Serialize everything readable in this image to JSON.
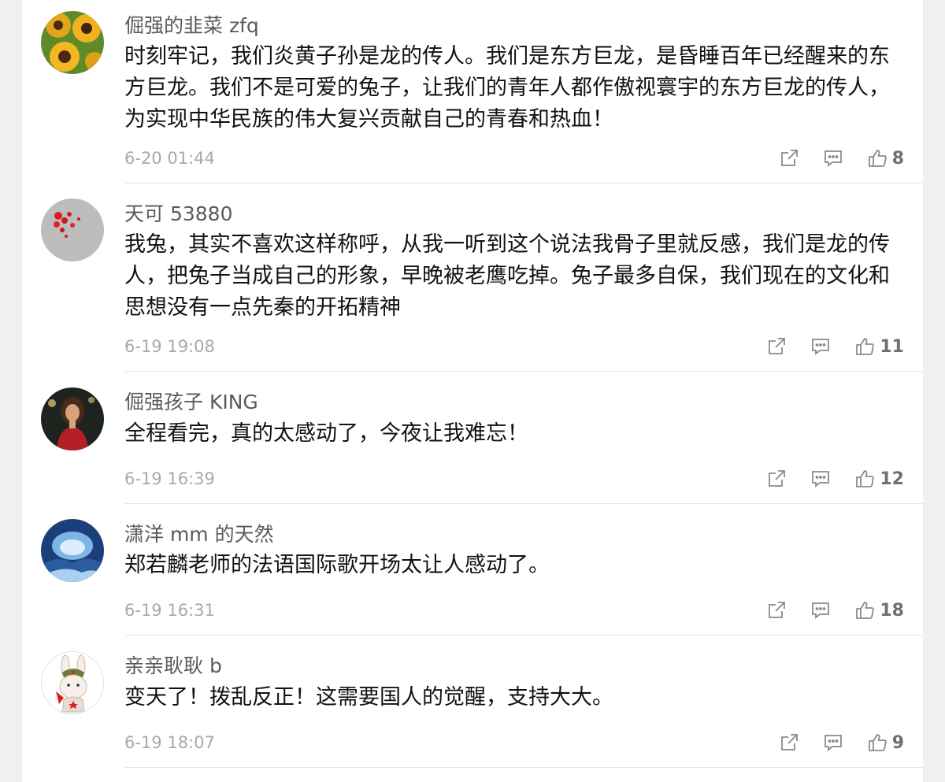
{
  "comments": [
    {
      "username": "倔强的韭菜 zfq",
      "text": "时刻牢记，我们炎黄子孙是龙的传人。我们是东方巨龙，是昏睡百年已经醒来的东方巨龙。我们不是可爱的兔子，让我们的青年人都作傲视寰宇的东方巨龙的传人，为实现中华民族的伟大复兴贡献自己的青春和热血！",
      "time": "6-20 01:44",
      "likes": "8",
      "avatar": "sunflower-avatar"
    },
    {
      "username": "天可 53880",
      "text": "我兔，其实不喜欢这样称呼，从我一听到这个说法我骨子里就反感，我们是龙的传人，把兔子当成自己的形象，早晚被老鹰吃掉。兔子最多自保，我们现在的文化和思想没有一点先秦的开拓精神",
      "time": "6-19 19:08",
      "likes": "11",
      "avatar": "red-berries-avatar"
    },
    {
      "username": "倔强孩子 KING",
      "text": "全程看完，真的太感动了，今夜让我难忘！",
      "time": "6-19 16:39",
      "likes": "12",
      "avatar": "woman-portrait-avatar"
    },
    {
      "username": "潇洋 mm 的天然",
      "text": "郑若麟老师的法语国际歌开场太让人感动了。",
      "time": "6-19 16:31",
      "likes": "18",
      "avatar": "ice-landscape-avatar"
    },
    {
      "username": "亲亲耿耿 b",
      "text": "变天了！拨乱反正！这需要国人的觉醒，支持大大。",
      "time": "6-19 18:07",
      "likes": "9",
      "avatar": "cartoon-rabbit-avatar"
    }
  ],
  "icons": {
    "share": "share-icon",
    "reply": "reply-icon",
    "like": "thumbs-up-icon"
  }
}
